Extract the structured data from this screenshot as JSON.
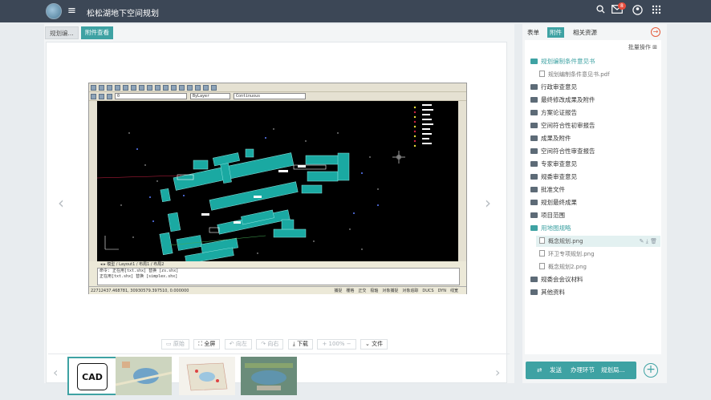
{
  "header": {
    "title": "松松湖地下空间规划",
    "badge": "8",
    "icons": [
      "logo-icon",
      "menu-add-icon",
      "search-icon",
      "mail-icon",
      "user-circle-icon",
      "apps-grid-icon"
    ]
  },
  "tabs": [
    {
      "label": "规划编..."
    },
    {
      "label": "附件查看"
    }
  ],
  "cad": {
    "layer": "0",
    "color": "ByLayer",
    "linetype": "Continuous",
    "layout_tabs": [
      "模型",
      "Layout1",
      "布局1",
      "布局2"
    ],
    "cmd_lines": [
      "命令: 正在用[txt.shx] 替换 [zs.shx]",
      "正在用[txt.shx] 替换 [simplex.shx]"
    ],
    "coords": "22712437.468781, 3093057​9.397510, 0.000000",
    "status_modes": [
      "捕捉",
      "栅格",
      "正交",
      "极轴",
      "对象捕捉",
      "对象追踪",
      "DUCS",
      "DYN",
      "线宽"
    ]
  },
  "toolbar": [
    {
      "label": "原始",
      "enabled": false
    },
    {
      "label": "全屏",
      "enabled": true
    },
    {
      "label": "向左",
      "enabled": false
    },
    {
      "label": "向右",
      "enabled": false
    },
    {
      "label": "下载",
      "enabled": true
    },
    {
      "label": "100%",
      "enabled": false
    },
    {
      "label": "文件",
      "enabled": true
    }
  ],
  "thumbnail_cad_label": "CAD",
  "right_panel": {
    "tabs": [
      "表单",
      "附件",
      "相关资源"
    ],
    "batch": "批量操作",
    "tree": [
      {
        "label": "规划编制条件意见书",
        "open": true
      },
      {
        "label": "规划编制条件意见书.pdf",
        "child": true
      },
      {
        "label": "行政审查意见"
      },
      {
        "label": "最终修改成果及附件"
      },
      {
        "label": "方案论证报告"
      },
      {
        "label": "空间符合性初审报告"
      },
      {
        "label": "成果及附件"
      },
      {
        "label": "空间符合性审查报告"
      },
      {
        "label": "专家审查意见"
      },
      {
        "label": "规委审查意见"
      },
      {
        "label": "批准文件"
      },
      {
        "label": "规划最终成果"
      },
      {
        "label": "项目范围"
      },
      {
        "label": "用地图规略",
        "open": true
      },
      {
        "label": "概念规划.png",
        "child": true,
        "selected": true
      },
      {
        "label": "环卫专项规划.png",
        "child": true
      },
      {
        "label": "概念规划2.png",
        "child": true
      },
      {
        "label": "规委会会议材料"
      },
      {
        "label": "其他资料"
      }
    ],
    "send": "发送",
    "flow_label": "办理环节",
    "flow_value": "规划局..."
  }
}
